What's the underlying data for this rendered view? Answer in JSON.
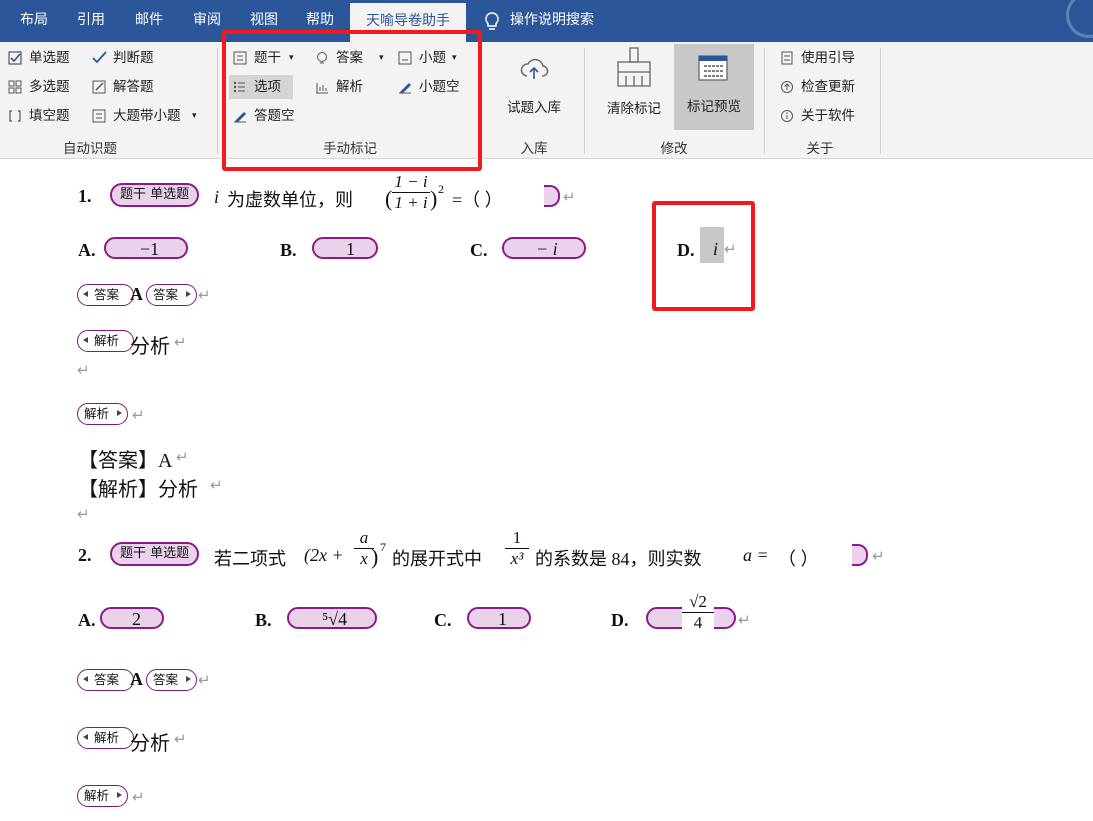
{
  "menu_tabs": [
    "布局",
    "引用",
    "邮件",
    "审阅",
    "视图",
    "帮助",
    "天喻导卷助手"
  ],
  "active_tab": "天喻导卷助手",
  "tell_me": "操作说明搜索",
  "ribbon": {
    "auto_group": {
      "label": "自动识题",
      "buttons": [
        "单选题",
        "判断题",
        "多选题",
        "解答题",
        "填空题",
        "大题带小题"
      ]
    },
    "manual_group": {
      "label": "手动标记",
      "buttons": [
        "题干",
        "答案",
        "小题",
        "选项",
        "解析",
        "小题空",
        "答题空"
      ]
    },
    "import_group": {
      "label": "入库",
      "button": "试题入库"
    },
    "modify_group": {
      "label": "修改",
      "buttons": [
        "清除标记",
        "标记预览"
      ]
    },
    "about_group": {
      "label": "关于",
      "buttons": [
        "使用引导",
        "检查更新",
        "关于软件"
      ]
    }
  },
  "doc": {
    "q1": {
      "num": "1.",
      "stem_tag": "题干 单选题",
      "var_i": "i",
      "text1": "为虚数单位，则",
      "frac_num": "1 − i",
      "frac_den": "1 + i",
      "exp": "2",
      "eq": "=（      ）",
      "options": {
        "a_label": "A.",
        "a_val": "−1",
        "b_label": "B.",
        "b_val": "1",
        "c_label": "C.",
        "c_val": "− i",
        "d_label": "D.",
        "d_val": "i"
      },
      "answer_tag": "答案",
      "answer_val": "A",
      "analysis_tag": "解析",
      "analysis_text": "分析",
      "answer_line": "【答案】A",
      "analysis_line": "【解析】分析"
    },
    "q2": {
      "num": "2.",
      "stem_tag": "题干 单选题",
      "text1": "若二项式",
      "expr": "(2x +",
      "frac_num": "a",
      "frac_den": "x",
      "exp": "7",
      "text2": "的展开式中",
      "frac2_num": "1",
      "frac2_den": "x³",
      "text3": "的系数是 84，则实数",
      "var_a": "a =",
      "eq": "（      ）",
      "options": {
        "a_label": "A.",
        "a_val": "2",
        "b_label": "B.",
        "b_val": "⁵√4",
        "c_label": "C.",
        "c_val": "1",
        "d_label": "D.",
        "d_num": "√2",
        "d_den": "4"
      },
      "answer_tag": "答案",
      "answer_val": "A",
      "analysis_tag": "解析",
      "analysis_text": "分析"
    },
    "return_mark": "↵"
  }
}
